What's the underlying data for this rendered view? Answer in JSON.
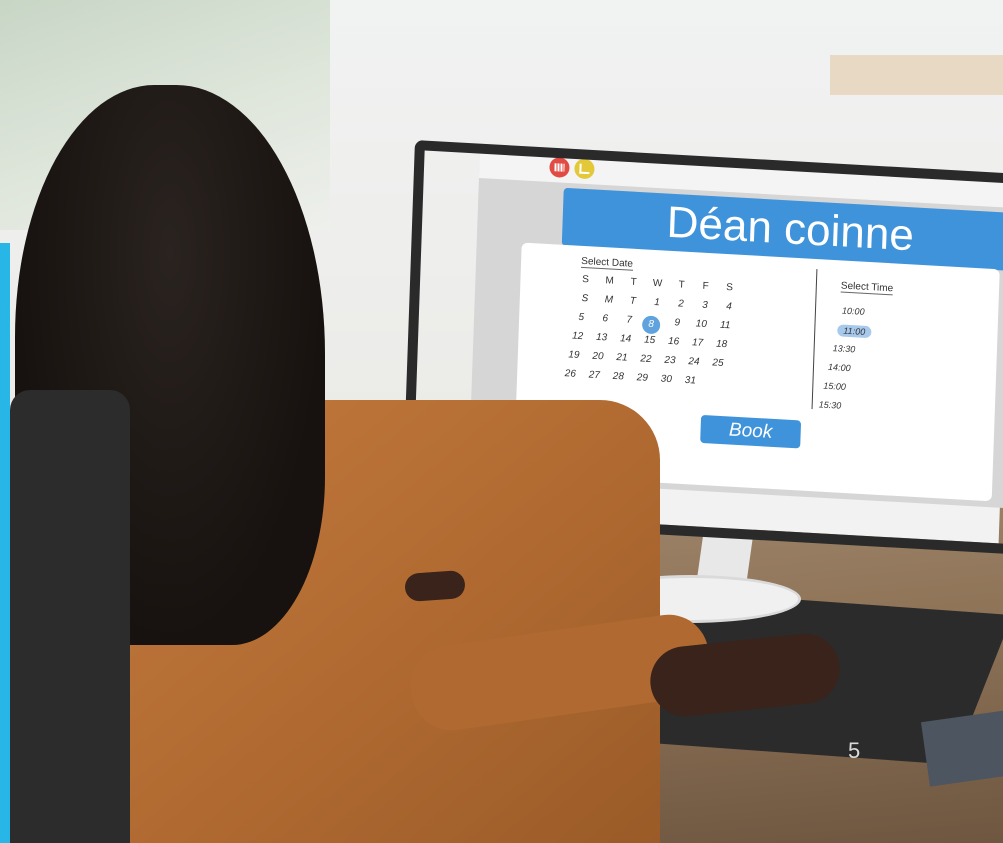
{
  "app": {
    "title": "Déan coinne",
    "header_icons": [
      "calendar-icon",
      "clock-icon",
      "user-avatar-icon"
    ]
  },
  "date_picker": {
    "label": "Select Date",
    "weekday_headers": [
      "S",
      "M",
      "T",
      "W",
      "T",
      "F",
      "S"
    ],
    "rows": [
      [
        "S",
        "M",
        "T",
        "1",
        "2",
        "3",
        "4"
      ],
      [
        "5",
        "6",
        "7",
        "8",
        "9",
        "10",
        "11"
      ],
      [
        "12",
        "13",
        "14",
        "15",
        "16",
        "17",
        "18"
      ],
      [
        "19",
        "20",
        "21",
        "22",
        "23",
        "24",
        "25"
      ],
      [
        "26",
        "27",
        "28",
        "29",
        "30",
        "31",
        ""
      ]
    ],
    "selected": "8"
  },
  "time_picker": {
    "label": "Select Time",
    "options": [
      "10:00",
      "11:00",
      "13:30",
      "14:00",
      "15:00",
      "15:30"
    ],
    "selected": "11:00"
  },
  "actions": {
    "book_label": "Book"
  },
  "page_number": "5",
  "colors": {
    "accent": "#3f93db",
    "selected": "#5fa2dd",
    "side_band": "#28b6e6"
  }
}
